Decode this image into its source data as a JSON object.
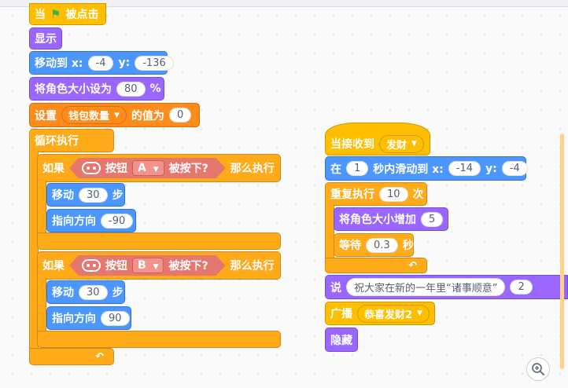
{
  "stack1": {
    "when_flag": {
      "prefix": "当",
      "flag_icon": "green-flag-icon",
      "suffix": "被点击"
    },
    "show": "显示",
    "goto": {
      "label": "移动到 x:",
      "x": "-4",
      "y_label": "y:",
      "y": "-136"
    },
    "set_size": {
      "label": "将角色大小设为",
      "value": "80",
      "unit": "%"
    },
    "set_var": {
      "label": "设置",
      "var": "钱包数量",
      "mid": "的值为",
      "value": "0"
    },
    "forever": "循环执行",
    "if1": {
      "label": "如果",
      "button_label": "按钮",
      "key": "A",
      "pressed": "被按下?",
      "then": "那么执行",
      "move": {
        "label": "移动",
        "value": "30",
        "unit": "步"
      },
      "point": {
        "label": "指向方向",
        "value": "-90"
      }
    },
    "if2": {
      "label": "如果",
      "button_label": "按钮",
      "key": "B",
      "pressed": "被按下?",
      "then": "那么执行",
      "move": {
        "label": "移动",
        "value": "30",
        "unit": "步"
      },
      "point": {
        "label": "指向方向",
        "value": "90"
      }
    }
  },
  "stack2": {
    "when_receive": {
      "label": "当接收到",
      "message": "发财"
    },
    "glide": {
      "label1": "在",
      "secs": "1",
      "label2": "秒内滑动到 x:",
      "x": "-14",
      "y_label": "y:",
      "y": "-4"
    },
    "repeat": {
      "label": "重复执行",
      "times": "10",
      "unit": "次"
    },
    "change_size": {
      "label": "将角色大小增加",
      "value": "5"
    },
    "wait": {
      "label": "等待",
      "value": "0.3",
      "unit": "秒"
    },
    "say": {
      "label": "说",
      "text": "祝大家在新的一年里“诸事顺意”",
      "secs": "2"
    },
    "broadcast": {
      "label": "广播",
      "message": "恭喜发财2"
    },
    "hide": "隐藏"
  },
  "colors": {
    "events": "#ffbf00",
    "looks": "#9966ff",
    "motion": "#4c97ff",
    "control": "#ffab19",
    "data": "#ff8c1a",
    "sensing": "#e6776e"
  },
  "ui": {
    "zoom_icon": "zoom-in-icon",
    "dropdown_icon": "caret-down-icon",
    "loop_icon": "loop-arrow-icon"
  }
}
